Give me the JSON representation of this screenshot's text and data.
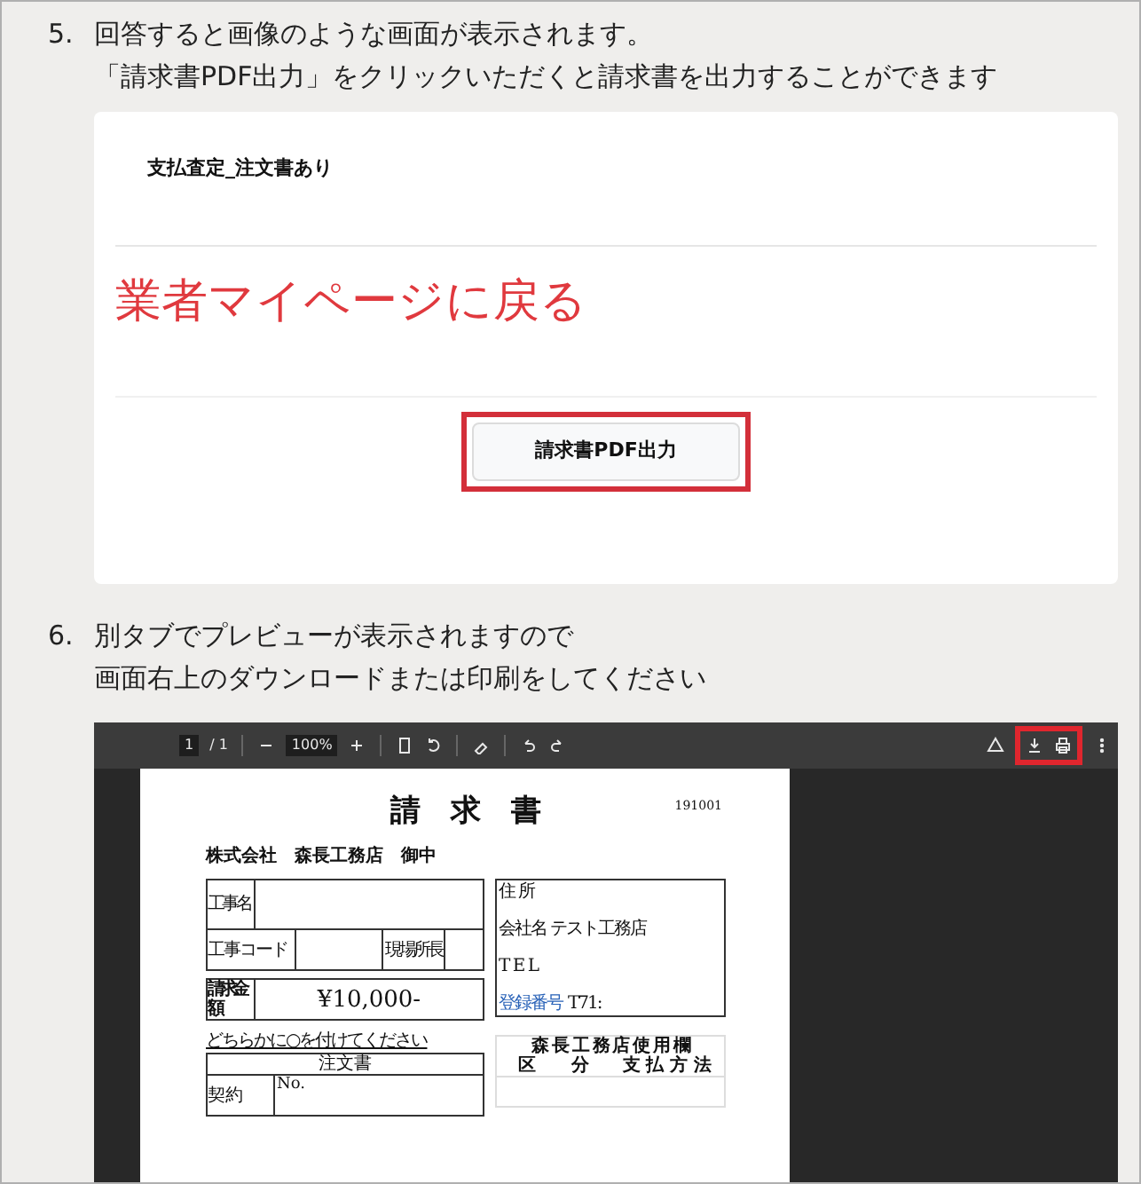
{
  "steps": [
    {
      "number": "5.",
      "lines": [
        "回答すると画像のような画面が表示されます。",
        "「請求書PDF出力」をクリックいただくと請求書を出力することができます"
      ]
    },
    {
      "number": "6.",
      "lines": [
        "別タブでプレビューが表示されますので",
        "画面右上のダウンロードまたは印刷をしてください"
      ]
    }
  ],
  "answer_screen": {
    "title": "支払査定_注文書あり",
    "back_link": "業者マイページに戻る",
    "button": {
      "label": "請求書PDF出力",
      "highlighted": true
    }
  },
  "pdf_viewer": {
    "page": "1",
    "page_total": "/ 1",
    "zoom": "100%",
    "actions_highlighted": true,
    "invoice": {
      "title": "請　求　書",
      "number": "191001",
      "addressee": "株式会社　森長工務店　御中",
      "work_name_label": "工事名",
      "work_code_label": "工事コード",
      "site_manager_label": "現場所長",
      "amount_label": "請求金額",
      "amount": "¥10,000-",
      "address_label": "住 所",
      "company": "会社名 テスト工務店",
      "tel": "T E L",
      "registration_label": "登録番号",
      "registration": "T71:",
      "instruction": "どちらかに○を付けてください",
      "order_label": "注文書",
      "contract_label": "契約",
      "no_label": "No.",
      "office_use_label": "森 長 工 務 店 使 用 欄",
      "category_label": "区　　分",
      "payment_label": "支 払 方 法"
    }
  }
}
